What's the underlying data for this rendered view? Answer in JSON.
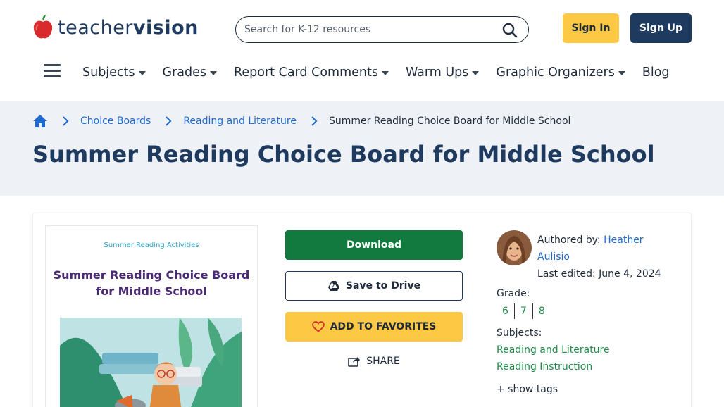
{
  "header": {
    "logo_part1": "teacher",
    "logo_part2": "vision",
    "search_placeholder": "Search for K-12 resources",
    "signin_label": "Sign In",
    "signup_label": "Sign Up"
  },
  "nav": {
    "items": [
      {
        "label": "Subjects",
        "has_dropdown": true
      },
      {
        "label": "Grades",
        "has_dropdown": true
      },
      {
        "label": "Report Card Comments",
        "has_dropdown": true
      },
      {
        "label": "Warm Ups",
        "has_dropdown": true
      },
      {
        "label": "Graphic Organizers",
        "has_dropdown": true
      },
      {
        "label": "Blog",
        "has_dropdown": false
      }
    ]
  },
  "breadcrumb": {
    "items": [
      "Choice Boards",
      "Reading and Literature"
    ],
    "current": "Summer Reading Choice Board for Middle School"
  },
  "page": {
    "title": "Summer Reading Choice Board for Middle School"
  },
  "thumbnail": {
    "subtitle": "Summer Reading Activities",
    "title_line1": "Summer Reading Choice Board",
    "title_line2": "for Middle School"
  },
  "actions": {
    "download_label": "Download",
    "drive_label": "Save to Drive",
    "favorites_label": "ADD TO FAVORITES",
    "share_label": "SHARE"
  },
  "meta": {
    "authored_prefix": "Authored by:",
    "author_name": "Heather Aulisio",
    "edited_prefix": "Last edited:",
    "edited_date": "June 4, 2024",
    "grade_label": "Grade:",
    "grades": [
      "6",
      "7",
      "8"
    ],
    "subjects_label": "Subjects:",
    "subjects": [
      "Reading and Literature",
      "Reading Instruction"
    ],
    "show_tags": "+ show tags"
  },
  "colors": {
    "navy": "#1f3a5f",
    "yellow": "#fdc843",
    "green": "#127a3e",
    "link_blue": "#1f6bd1",
    "tag_green": "#1f8c4a",
    "hero_bg": "#eef1f6"
  },
  "icons": [
    "apple-logo-icon",
    "search-icon",
    "hamburger-menu-icon",
    "home-icon",
    "chevron-right-icon",
    "google-drive-icon",
    "heart-icon",
    "share-icon"
  ]
}
